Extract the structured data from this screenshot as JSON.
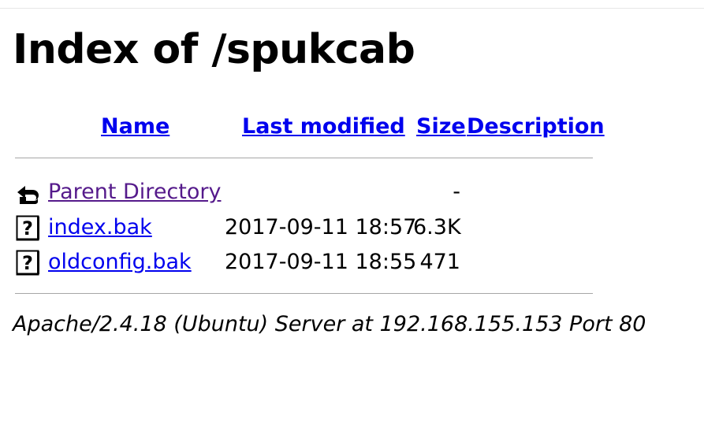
{
  "page": {
    "title": "Index of /spukcab"
  },
  "table": {
    "columns": {
      "name": "Name",
      "last_modified": "Last modified",
      "size": "Size",
      "description": "Description"
    },
    "rows": [
      {
        "name": "Parent Directory",
        "last_modified": "",
        "size": "-",
        "icon": "back-arrow-icon"
      },
      {
        "name": "index.bak",
        "last_modified": "2017-09-11 18:57",
        "size": "6.3K",
        "icon": "unknown-file-icon"
      },
      {
        "name": "oldconfig.bak",
        "last_modified": "2017-09-11 18:55",
        "size": "471",
        "icon": "unknown-file-icon"
      }
    ]
  },
  "footer": {
    "address": "Apache/2.4.18 (Ubuntu) Server at 192.168.155.153 Port 80"
  },
  "colors": {
    "link": "#0000ee",
    "visited_link": "#551a8b",
    "rule": "#a6a6a6"
  }
}
